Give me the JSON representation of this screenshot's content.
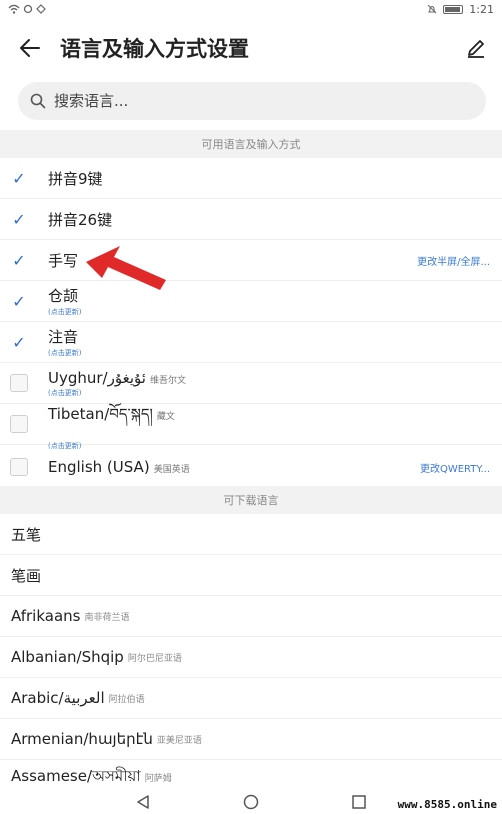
{
  "status_bar": {
    "time": "1:21"
  },
  "header": {
    "title": "语言及输入方式设置"
  },
  "search": {
    "placeholder": "搜索语言..."
  },
  "sections": {
    "available": "可用语言及输入方式",
    "downloadable": "可下载语言"
  },
  "languages": [
    {
      "label": "拼音9键",
      "checked": true
    },
    {
      "label": "拼音26键",
      "checked": true
    },
    {
      "label": "手写",
      "checked": true,
      "action": "更改半屏/全屏..."
    },
    {
      "label": "仓颉",
      "checked": true,
      "update": "(点击更新)"
    },
    {
      "label": "注音",
      "checked": true,
      "update": "(点击更新)"
    },
    {
      "label": "Uyghur/ئۇيغۇر",
      "sub": "维吾尔文",
      "checked": false,
      "update": "(点击更新)"
    },
    {
      "label": "Tibetan/བོད་སྐད།",
      "sub": "藏文",
      "checked": false,
      "update": "(点击更新)"
    },
    {
      "label": "English (USA)",
      "sub": "美国英语",
      "checked": false,
      "action": "更改QWERTY..."
    }
  ],
  "downloads": [
    {
      "label": "五笔"
    },
    {
      "label": "笔画"
    },
    {
      "label": "Afrikaans",
      "sub": "南非荷兰语"
    },
    {
      "label": "Albanian/Shqip",
      "sub": "阿尔巴尼亚语"
    },
    {
      "label": "Arabic/العربية",
      "sub": "阿拉伯语"
    },
    {
      "label": "Armenian/հայերէն",
      "sub": "亚美尼亚语"
    },
    {
      "label": "Assamese/অসমীয়া",
      "sub": "阿萨姆"
    }
  ],
  "watermark": "www.8585.online",
  "colors": {
    "accent": "#2f6dd6",
    "arrow": "#e02a2a"
  }
}
